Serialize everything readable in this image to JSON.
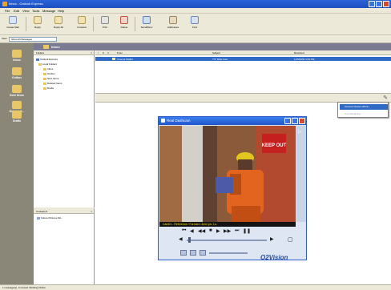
{
  "window": {
    "title": "Inbox - Outlook Express"
  },
  "menu": [
    "File",
    "Edit",
    "View",
    "Tools",
    "Message",
    "Help"
  ],
  "toolbar": {
    "create_mail": "Create Mail",
    "reply": "Reply",
    "reply_all": "Reply All",
    "forward": "Forward",
    "print": "Print",
    "delete": "Delete",
    "send_recv": "Send/Recv",
    "addresses": "Addresses",
    "find": "Find"
  },
  "view": {
    "label": "View:",
    "value": "Show All Messages"
  },
  "outlook_bar": [
    "Inbox",
    "Outbox",
    "Sent Items",
    "Deleted It...",
    "Drafts"
  ],
  "folder_header": "Inbox",
  "folders": {
    "header": "Folders",
    "items": [
      "Outlook Express",
      "Local Folders",
      "Inbox",
      "Outbox",
      "Sent Items",
      "Deleted Items",
      "Drafts"
    ]
  },
  "contacts": {
    "header": "Contacts ▾",
    "items": [
      "Future Pictures Mo..."
    ]
  },
  "messages": {
    "columns": [
      "!",
      "0",
      "▽",
      "From",
      "Subject",
      "Received"
    ],
    "rows": [
      {
        "from": "Cinema Staffel",
        "subject": "TIT: Mitte Foto",
        "received": "1/15/2004 4:53 PM"
      }
    ]
  },
  "popup_menu": [
    "Camera Viewer (SD-E...",
    "Live Streaming..."
  ],
  "viewer": {
    "title": "Real Dashcam",
    "overlay": "Cam01 - Reference / Format 1    4mm   ps: 1 ▸",
    "logo": "O2Vision",
    "sign_text": "KEEP OUT"
  },
  "status": "1 message(s), 0 unread, Working Online",
  "colors": {
    "accent": "#316ac5",
    "titlebar": "#1d4fc0",
    "panel": "#ece9d8",
    "outlook_bar": "#8a8778"
  }
}
